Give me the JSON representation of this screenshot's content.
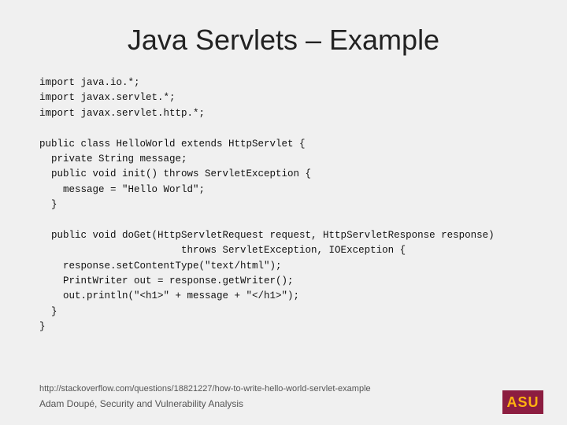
{
  "slide": {
    "title": "Java Servlets – Example",
    "code": "import java.io.*;\nimport javax.servlet.*;\nimport javax.servlet.http.*;\n\npublic class HelloWorld extends HttpServlet {\n  private String message;\n  public void init() throws ServletException {\n    message = \"Hello World\";\n  }\n\n  public void doGet(HttpServletRequest request, HttpServletResponse response)\n                        throws ServletException, IOException {\n    response.setContentType(\"text/html\");\n    PrintWriter out = response.getWriter();\n    out.println(\"<h1>\" + message + \"</h1>\");\n  }\n}",
    "footer_url": "http://stackoverflow.com/questions/18821227/how-to-write-hello-world-servlet-example",
    "footer_name": "Adam Doupé, Security and Vulnerability Analysis",
    "logo_text": "ASU",
    "logo_colors": {
      "bg": "#8C1D40",
      "text": "#FFB310"
    }
  }
}
